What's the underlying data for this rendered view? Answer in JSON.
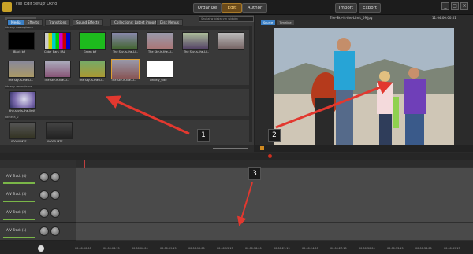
{
  "menu": {
    "file": "File",
    "edit": "Edit",
    "setup": "Setup",
    "help": "? Okno"
  },
  "modes": {
    "organize": "Organize",
    "edit": "Edit",
    "author": "Author",
    "import": "Import",
    "export": "Export"
  },
  "library": {
    "search_placeholder": "Szukaj w bieżącym widoku",
    "tabs": [
      {
        "label": "Media",
        "active": true
      },
      {
        "label": "Effects"
      },
      {
        "label": "Transitions"
      },
      {
        "label": "Sound Effects"
      },
      {
        "label": "Collections: Latest import"
      },
      {
        "label": "Disc Menus"
      }
    ],
    "sections": {
      "images": "Obrazy wewnętrzne",
      "videos": "Obrazy zewnętrzne",
      "camera": "kamera_2"
    },
    "thumbs_row1": [
      "Black bif",
      "Color_Bars_PAL",
      "Green bif",
      "The Sky-is-the-Li...",
      "The Sky-is-the-Li...",
      "The Sky-is-the-Li..."
    ],
    "thumbs_row2": [
      "The Sky-is-the-Li...",
      "The Sky-is-the-Li...",
      "The Sky-is-the-Li...",
      "The Sky-is-the-Li...",
      "whitely_side"
    ],
    "video_label": "the-sky-is-the-limit",
    "camera_items": [
      "00000.MTS",
      "00005.MTS"
    ]
  },
  "preview": {
    "filename": "The-Sky-is-the-Limit_09.jpg",
    "timecode": "11:04:00:00:01",
    "tabs": [
      "Source",
      "Timeline"
    ]
  },
  "timeline": {
    "tracks": [
      "A/V Track (4)",
      "A/V Track (3)",
      "A/V Track (2)",
      "A/V Track (1)"
    ],
    "ruler": [
      "00:00:00.00",
      "00:00:03.15",
      "00:00:06.00",
      "00:00:09.15",
      "00:00:12.00",
      "00:00:15.15",
      "00:00:18.00",
      "00:00:21.15",
      "00:00:24.00",
      "00:00:27.15",
      "00:00:30.00",
      "00:00:33.15",
      "00:00:36.00",
      "00:00:39.15"
    ]
  },
  "callouts": [
    "1",
    "2",
    "3"
  ],
  "colors": {
    "accent_blue": "#3b7fc4",
    "arrow_red": "#e2382f",
    "edit_mode_gold": "#ffd37a"
  }
}
